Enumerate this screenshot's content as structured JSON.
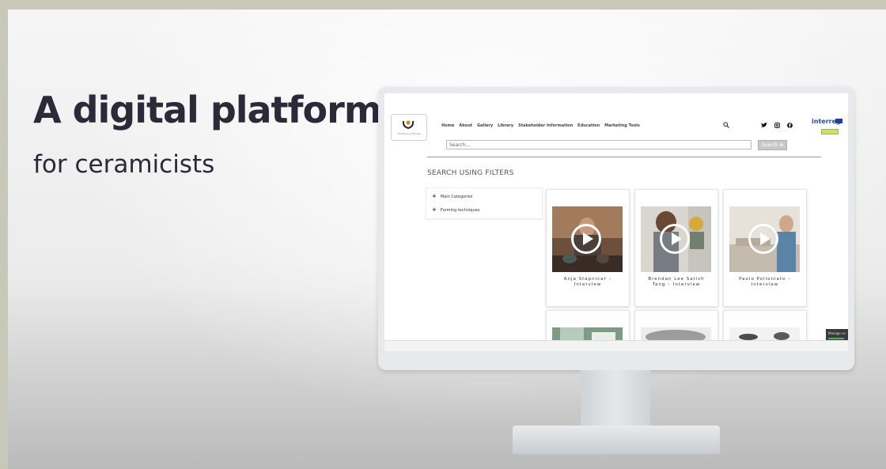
{
  "slide": {
    "headline": "A digital platform",
    "subline": "for ceramicists"
  },
  "site": {
    "logo_caption": "Ceramics in Europe",
    "nav": [
      "Home",
      "About",
      "Gallery",
      "Library",
      "Stakeholder Information",
      "Education",
      "Marketing Tools"
    ],
    "partner_logo": "interreg",
    "search": {
      "placeholder": "Search...",
      "button_label": "Search"
    },
    "filters_title": "SEARCH USING FILTERS",
    "filters": [
      "Main Categories",
      "Forming techniques"
    ],
    "videos": [
      {
        "title": "Anja Stapnicar –\nInterview"
      },
      {
        "title": "Brendan Lee Satish\nTang – Interview"
      },
      {
        "title": "Paolo Polloniato –\nInterview"
      }
    ],
    "side_widget_label": "Manage co"
  },
  "icons": [
    "search-icon",
    "twitter-icon",
    "instagram-icon",
    "facebook-icon",
    "play-icon",
    "plus-icon"
  ]
}
